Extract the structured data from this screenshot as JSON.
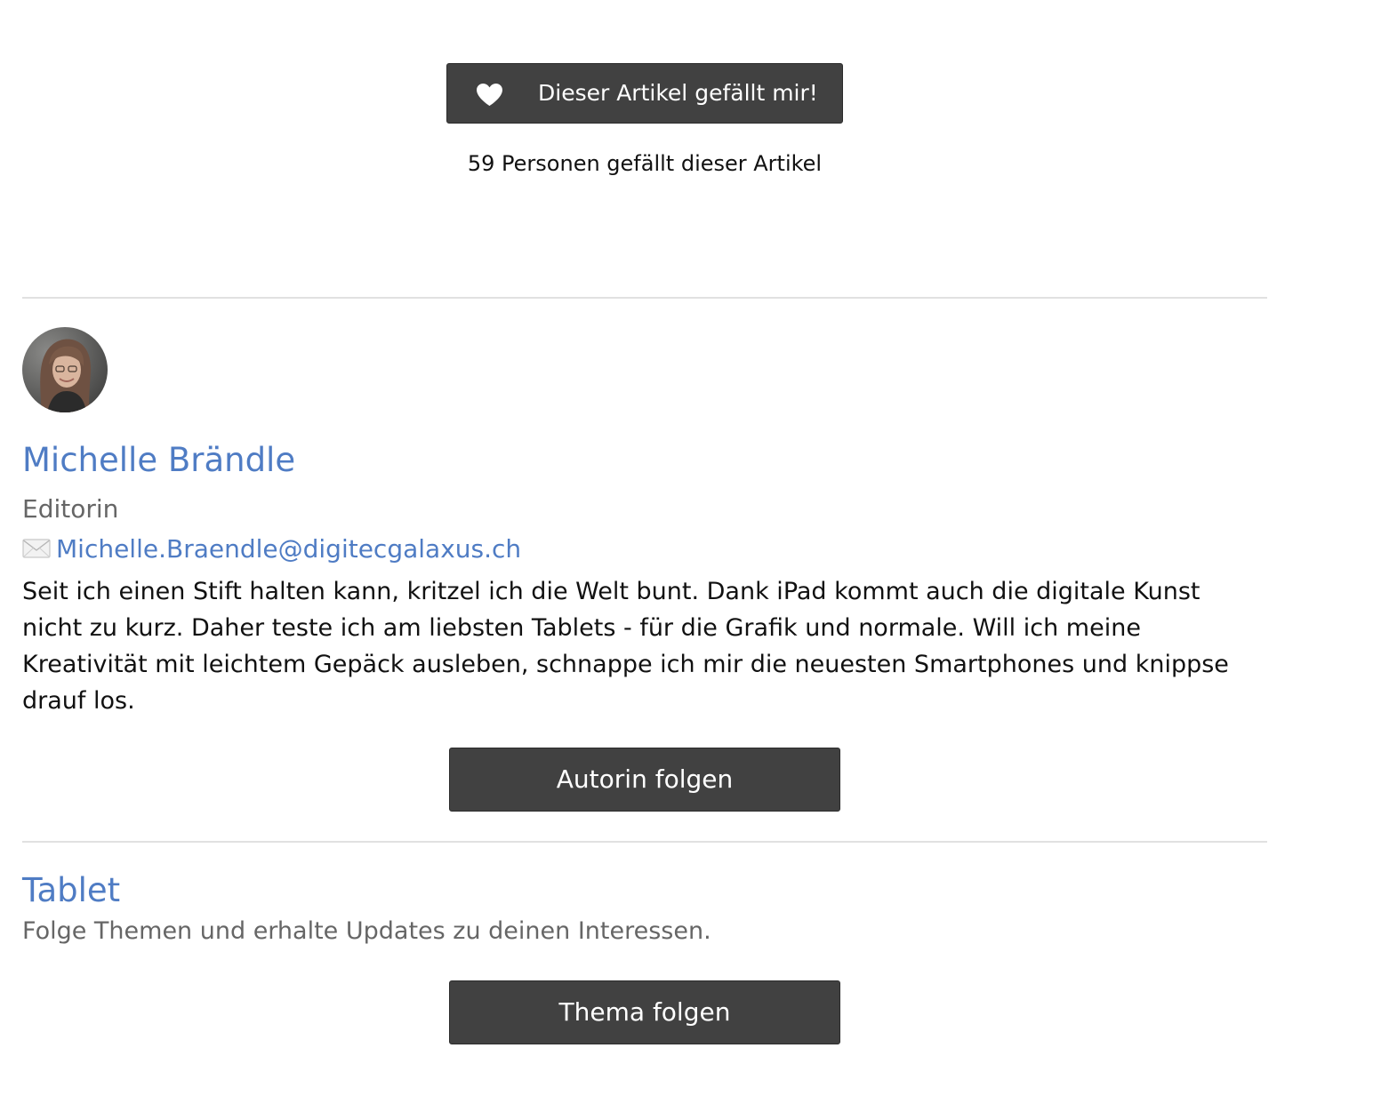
{
  "like": {
    "button_label": "Dieser Artikel gefällt mir!",
    "count_text": "59 Personen gefällt dieser Artikel",
    "icon": "heart-icon"
  },
  "author": {
    "name": "Michelle Brändle",
    "role": "Editorin",
    "email_icon": "mail-icon",
    "email": "Michelle.Braendle@digitecgalaxus.ch",
    "bio": "Seit ich einen Stift halten kann, kritzel ich die Welt bunt. Dank iPad kommt auch die digitale Kunst nicht zu kurz. Daher teste ich am liebsten Tablets - für die Grafik und normale. Will ich meine Kreativität mit leichtem Gepäck ausleben, schnappe ich mir die neuesten Smartphones und knippse drauf los.",
    "follow_label": "Autorin folgen"
  },
  "topic": {
    "title": "Tablet",
    "subtitle": "Folge Themen und erhalte Updates zu deinen Interessen.",
    "follow_label": "Thema folgen"
  },
  "colors": {
    "link": "#4f7cc4",
    "button_bg": "#414141",
    "muted_text": "#666666",
    "divider": "#e1e1e1"
  }
}
